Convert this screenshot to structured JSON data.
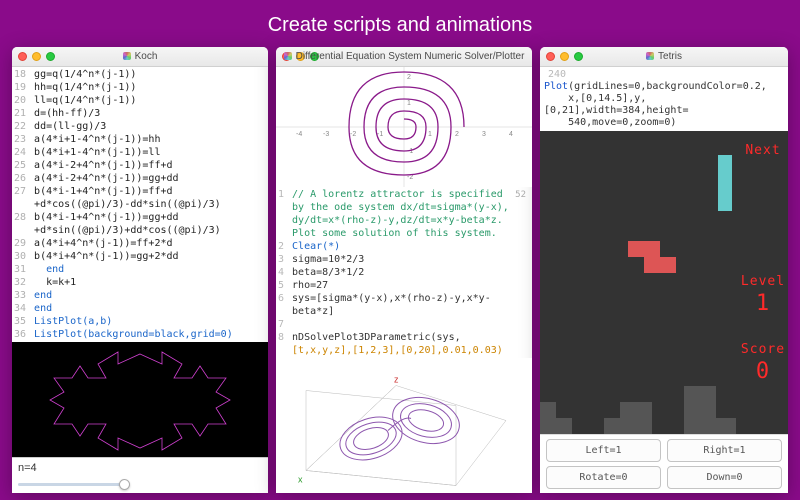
{
  "banner": "Create scripts and animations",
  "windows": {
    "koch": {
      "title": "Koch",
      "lines": [
        {
          "n": 18,
          "t": "gg=q(1/4^n*(j-1))"
        },
        {
          "n": 19,
          "t": "hh=q(1/4^n*(j-1))"
        },
        {
          "n": 20,
          "t": "ll=q(1/4^n*(j-1))"
        },
        {
          "n": 21,
          "t": "d=(hh-ff)/3"
        },
        {
          "n": 22,
          "t": "dd=(ll-gg)/3"
        },
        {
          "n": 23,
          "t": "a(4*i+1-4^n*(j-1))=hh"
        },
        {
          "n": 24,
          "t": "b(4*i+1-4^n*(j-1))=ll"
        },
        {
          "n": 25,
          "t": "a(4*i-2+4^n*(j-1))=ff+d"
        },
        {
          "n": 26,
          "t": "a(4*i-2+4^n*(j-1))=gg+dd"
        },
        {
          "n": 27,
          "t": "b(4*i-1+4^n*(j-1))=ff+d"
        },
        {
          "n": "",
          "t": "+d*cos((@pi)/3)-dd*sin((@pi)/3)"
        },
        {
          "n": 28,
          "t": "b(4*i-1+4^n*(j-1))=gg+dd"
        },
        {
          "n": "",
          "t": "+d*sin((@pi)/3)+dd*cos((@pi)/3)"
        },
        {
          "n": 29,
          "t": "a(4*i+4^n*(j-1))=ff+2*d"
        },
        {
          "n": 30,
          "t": "b(4*i+4^n*(j-1))=gg+2*dd"
        },
        {
          "n": 31,
          "t": "  end",
          "cls": "kw"
        },
        {
          "n": 32,
          "t": "  k=k+1"
        },
        {
          "n": 33,
          "t": "end",
          "cls": "kw"
        },
        {
          "n": 34,
          "t": "end",
          "cls": "kw"
        },
        {
          "n": 35,
          "t": "ListPlot(a,b)",
          "cls": "fn"
        },
        {
          "n": 36,
          "t": "ListPlot(background=black,grid=0)",
          "cls": "fn"
        }
      ],
      "slider_label": "n=4",
      "slider_value": 4
    },
    "ode": {
      "title": "Differential Equation System Numeric Solver/Plotter",
      "line_count": "52",
      "lines": [
        {
          "n": 1,
          "t": "// A lorentz attractor is specified",
          "cls": "cm"
        },
        {
          "n": "",
          "t": "by the ode system dx/dt=sigma*(y-x),",
          "cls": "cm"
        },
        {
          "n": "",
          "t": "dy/dt=x*(rho-z)-y,dz/dt=x*y-beta*z.",
          "cls": "cm"
        },
        {
          "n": "",
          "t": "Plot some solution of this system.",
          "cls": "cm"
        },
        {
          "n": 2,
          "t": "Clear(*)",
          "cls": "fn"
        },
        {
          "n": 3,
          "t": "sigma=10*2/3"
        },
        {
          "n": 4,
          "t": "beta=8/3*1/2"
        },
        {
          "n": 5,
          "t": "rho=27"
        },
        {
          "n": 6,
          "t": "sys=[sigma*(y-x),x*(rho-z)-y,x*y-"
        },
        {
          "n": "",
          "t": "beta*z]"
        },
        {
          "n": 7,
          "t": ""
        },
        {
          "n": 8,
          "t": "nDSolvePlot3DParametric(sys,"
        },
        {
          "n": "",
          "t": "[t,x,y,z],[1,2,3],[0,20],0.01,0.03)",
          "cls": "brk"
        }
      ]
    },
    "tetris": {
      "title": "Tetris",
      "header_line_no": "240",
      "header_code": "Plot(gridLines=0,backgroundColor=0.2,x,[0,14.5],y,[0,21],width=384,height=540,move=0,zoom=0)",
      "labels": {
        "next": "Next",
        "level": "Level",
        "score": "Score"
      },
      "values": {
        "level": "1",
        "score": "0"
      },
      "next_color": "#66cccc",
      "piece_color": "#dd5555",
      "ground_color": "#555555",
      "buttons": {
        "left": "Left=1",
        "right": "Right=1",
        "rotate": "Rotate=0",
        "down": "Down=0"
      }
    }
  },
  "colors": {
    "brand": "#8a0b8a"
  }
}
